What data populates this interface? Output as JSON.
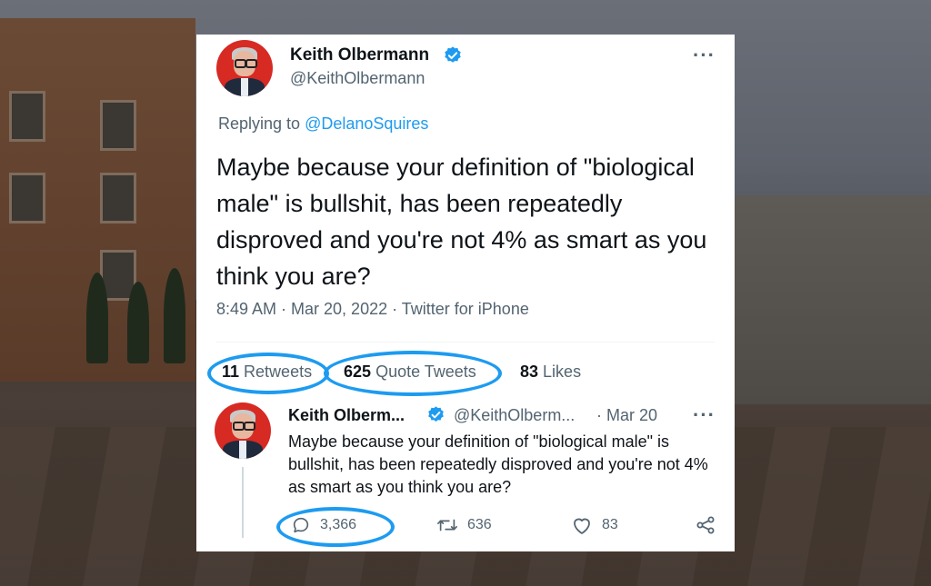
{
  "tweet": {
    "author_name": "Keith Olbermann",
    "author_handle": "@KeithOlbermann",
    "more_icon": "more-dots-icon",
    "replying_prefix": "Replying to",
    "replying_to": "@DelanoSquires",
    "text": "Maybe because your definition of \"biological male\" is bullshit, has been repeatedly disproved and you're not 4% as smart as you think you are?",
    "timestamp": "8:49 AM · Mar 20, 2022 · Twitter for iPhone",
    "stats": {
      "retweets_count": "11",
      "retweets_label": "Retweets",
      "quotes_count": "625",
      "quotes_label": "Quote Tweets",
      "likes_count": "83",
      "likes_label": "Likes"
    }
  },
  "reply_card": {
    "author_name": "Keith Olberm...",
    "author_handle": "@KeithOlberm...",
    "date": "· Mar 20",
    "text": "Maybe because your definition of \"biological male\" is bullshit, has been repeatedly disproved and you're not 4% as smart as you think you are?",
    "actions": {
      "reply_count": "3,366",
      "retweet_count": "636",
      "like_count": "83"
    }
  },
  "colors": {
    "accent": "#1d9bf0",
    "avatar_bg": "#d62a23",
    "text_primary": "#0f1419",
    "text_secondary": "#536471"
  }
}
